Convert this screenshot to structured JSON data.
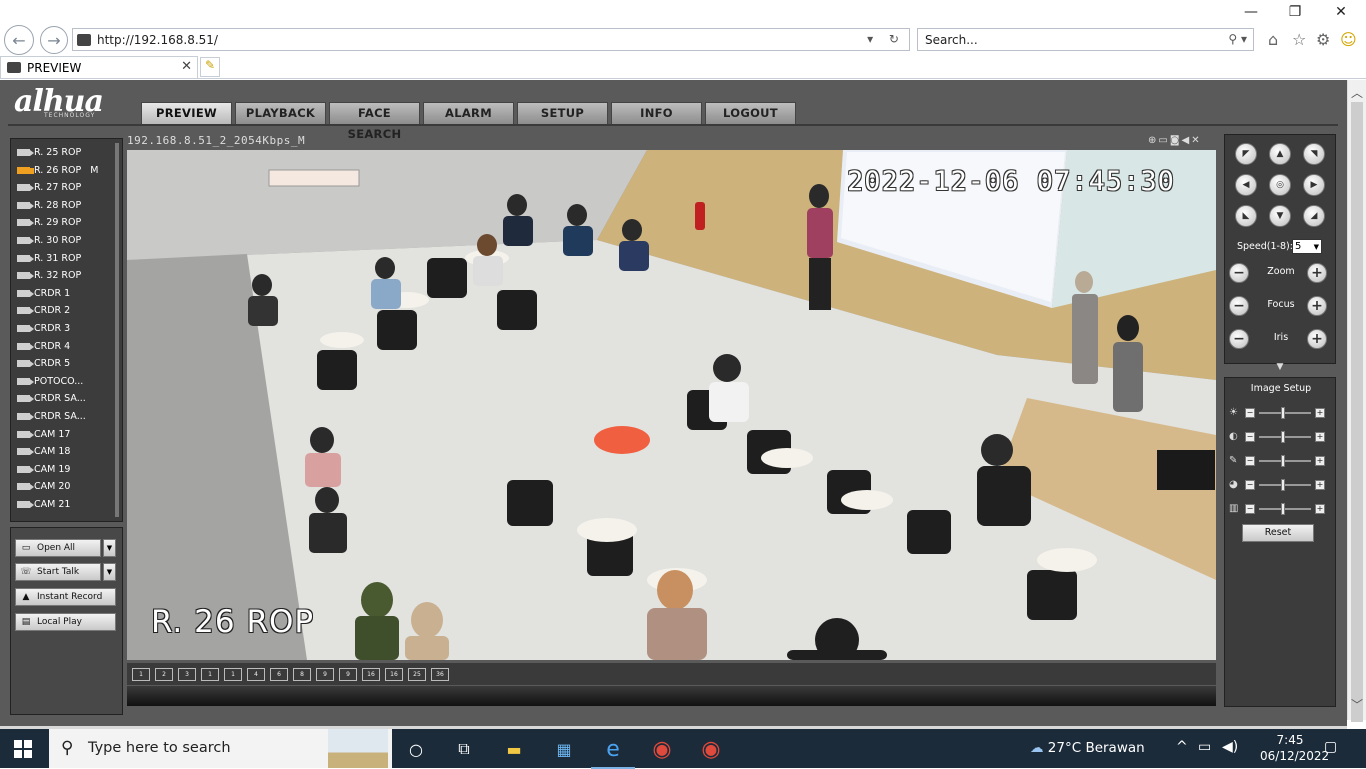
{
  "browser": {
    "url": "http://192.168.8.51/",
    "search_placeholder": "Search...",
    "tab_title": "PREVIEW"
  },
  "app": {
    "logo": "alhua",
    "logo_sub": "TECHNOLOGY",
    "menu": [
      "PREVIEW",
      "PLAYBACK",
      "FACE SEARCH",
      "ALARM",
      "SETUP",
      "INFO",
      "LOGOUT"
    ],
    "active_menu": "PREVIEW"
  },
  "channels": [
    {
      "label": "R. 25 ROP",
      "suffix": ""
    },
    {
      "label": "R. 26 ROP",
      "suffix": "M",
      "active": true
    },
    {
      "label": "R. 27 ROP",
      "suffix": ""
    },
    {
      "label": "R. 28 ROP",
      "suffix": ""
    },
    {
      "label": "R. 29 ROP",
      "suffix": ""
    },
    {
      "label": "R. 30 ROP",
      "suffix": ""
    },
    {
      "label": "R. 31 ROP",
      "suffix": ""
    },
    {
      "label": "R. 32 ROP",
      "suffix": ""
    },
    {
      "label": "CRDR 1",
      "suffix": ""
    },
    {
      "label": "CRDR 2",
      "suffix": ""
    },
    {
      "label": "CRDR 3",
      "suffix": ""
    },
    {
      "label": "CRDR 4",
      "suffix": ""
    },
    {
      "label": "CRDR 5",
      "suffix": ""
    },
    {
      "label": "POTOCO...",
      "suffix": ""
    },
    {
      "label": "CRDR SA...",
      "suffix": ""
    },
    {
      "label": "CRDR SA...",
      "suffix": ""
    },
    {
      "label": "CAM 17",
      "suffix": ""
    },
    {
      "label": "CAM 18",
      "suffix": ""
    },
    {
      "label": "CAM 19",
      "suffix": ""
    },
    {
      "label": "CAM 20",
      "suffix": ""
    },
    {
      "label": "CAM 21",
      "suffix": ""
    }
  ],
  "controls": {
    "open_all": "Open All",
    "start_talk": "Start Talk",
    "instant_record": "Instant Record",
    "local_play": "Local Play"
  },
  "video": {
    "stream_label": "192.168.8.51_2_2054Kbps_M",
    "osd_time": "2022-12-06 07:45:30",
    "osd_channel": "R. 26 ROP",
    "layouts": [
      "1",
      "2",
      "3",
      "1",
      "1",
      "4",
      "6",
      "8",
      "9",
      "9",
      "16",
      "16",
      "25",
      "36"
    ]
  },
  "ptz": {
    "speed_label": "Speed(1-8):",
    "speed_value": "5",
    "zoom_label": "Zoom",
    "focus_label": "Focus",
    "iris_label": "Iris"
  },
  "image_setup": {
    "title": "Image Setup",
    "reset_label": "Reset"
  },
  "taskbar": {
    "search_placeholder": "Type here to search",
    "weather": "27°C  Berawan",
    "time": "7:45",
    "date": "06/12/2022"
  },
  "colors": {
    "app_bg": "#5a5a5a",
    "panel_bg": "#3c3c3c",
    "active_channel": "#f0a020",
    "taskbar_bg": "#1c2b3a"
  }
}
